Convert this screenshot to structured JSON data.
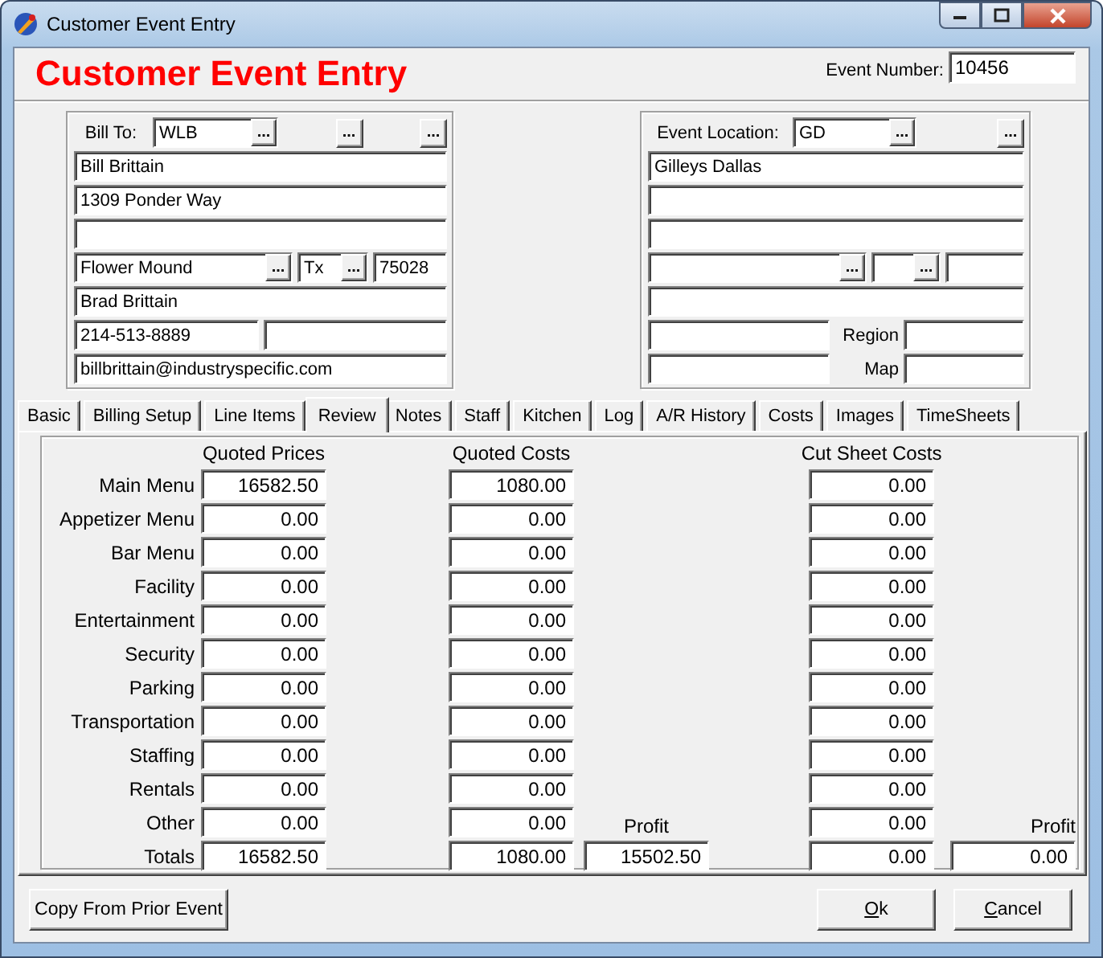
{
  "window": {
    "title": "Customer Event Entry"
  },
  "header": {
    "title": "Customer Event Entry",
    "event_number": {
      "label": "Event Number:",
      "value": "10456"
    }
  },
  "bill_to": {
    "lines": [
      {
        "items": [
          {
            "kind": "label",
            "text": "Bill To:"
          },
          {
            "kind": "field",
            "value": "WLB",
            "lookup": "..."
          },
          {
            "kind": "button",
            "text": "..."
          },
          {
            "kind": "button",
            "text": "..."
          }
        ]
      },
      {
        "items": [
          {
            "kind": "field",
            "value": "Bill Brittain"
          }
        ]
      },
      {
        "items": [
          {
            "kind": "field",
            "value": "1309 Ponder Way"
          }
        ]
      },
      {
        "items": [
          {
            "kind": "field"
          }
        ]
      },
      {
        "items": [
          {
            "kind": "field",
            "value": "Flower Mound",
            "lookup": "..."
          },
          {
            "kind": "field",
            "value": "Tx",
            "lookup": "..."
          },
          {
            "kind": "field",
            "value": "75028"
          }
        ]
      },
      {
        "items": [
          {
            "kind": "field",
            "value": "Brad Brittain"
          }
        ]
      },
      {
        "items": [
          {
            "kind": "field",
            "value": "214-513-8889"
          },
          {
            "kind": "field"
          }
        ]
      },
      {
        "items": [
          {
            "kind": "field",
            "value": "billbrittain@industryspecific.com"
          }
        ]
      }
    ]
  },
  "event_location": {
    "lines": [
      {
        "items": [
          {
            "kind": "label",
            "text": "Event Location:"
          },
          {
            "kind": "field",
            "value": "GD",
            "lookup": "..."
          },
          {
            "kind": "button",
            "text": "..."
          }
        ]
      },
      {
        "items": [
          {
            "kind": "field",
            "value": "Gilleys Dallas"
          }
        ]
      },
      {
        "items": [
          {
            "kind": "field"
          }
        ]
      },
      {
        "items": [
          {
            "kind": "field"
          }
        ]
      },
      {
        "items": [
          {
            "kind": "field",
            "lookup": "..."
          },
          {
            "kind": "field",
            "lookup": "..."
          },
          {
            "kind": "field"
          }
        ]
      },
      {
        "items": [
          {
            "kind": "field"
          }
        ]
      },
      {
        "items": [
          {
            "kind": "field"
          },
          {
            "kind": "label",
            "text": "Region"
          },
          {
            "kind": "field"
          }
        ]
      },
      {
        "items": [
          {
            "kind": "field"
          },
          {
            "kind": "label",
            "text": "Map"
          },
          {
            "kind": "field"
          }
        ]
      }
    ]
  },
  "tabs": [
    {
      "label": "Basic",
      "selected": false
    },
    {
      "label": "Billing Setup",
      "selected": false
    },
    {
      "label": "Line Items",
      "selected": false
    },
    {
      "label": "Review",
      "selected": true
    },
    {
      "label": "Notes",
      "selected": false
    },
    {
      "label": "Staff",
      "selected": false
    },
    {
      "label": "Kitchen",
      "selected": false
    },
    {
      "label": "Log",
      "selected": false
    },
    {
      "label": "A/R History",
      "selected": false
    },
    {
      "label": "Costs",
      "selected": false
    },
    {
      "label": "Images",
      "selected": false
    },
    {
      "label": "TimeSheets",
      "selected": false
    }
  ],
  "review": {
    "headings": [
      "Quoted Prices",
      "Quoted Costs",
      "Cut Sheet Costs"
    ],
    "rows": [
      {
        "label": "Main Menu",
        "quoted_price": "16582.50",
        "quoted_cost": "1080.00",
        "cut_sheet_cost": "0.00"
      },
      {
        "label": "Appetizer Menu",
        "quoted_price": "0.00",
        "quoted_cost": "0.00",
        "cut_sheet_cost": "0.00"
      },
      {
        "label": "Bar Menu",
        "quoted_price": "0.00",
        "quoted_cost": "0.00",
        "cut_sheet_cost": "0.00"
      },
      {
        "label": "Facility",
        "quoted_price": "0.00",
        "quoted_cost": "0.00",
        "cut_sheet_cost": "0.00"
      },
      {
        "label": "Entertainment",
        "quoted_price": "0.00",
        "quoted_cost": "0.00",
        "cut_sheet_cost": "0.00"
      },
      {
        "label": "Security",
        "quoted_price": "0.00",
        "quoted_cost": "0.00",
        "cut_sheet_cost": "0.00"
      },
      {
        "label": "Parking",
        "quoted_price": "0.00",
        "quoted_cost": "0.00",
        "cut_sheet_cost": "0.00"
      },
      {
        "label": "Transportation",
        "quoted_price": "0.00",
        "quoted_cost": "0.00",
        "cut_sheet_cost": "0.00"
      },
      {
        "label": "Staffing",
        "quoted_price": "0.00",
        "quoted_cost": "0.00",
        "cut_sheet_cost": "0.00"
      },
      {
        "label": "Rentals",
        "quoted_price": "0.00",
        "quoted_cost": "0.00",
        "cut_sheet_cost": "0.00"
      },
      {
        "label": "Other",
        "quoted_price": "0.00",
        "quoted_cost": "0.00",
        "cut_sheet_cost": "0.00"
      }
    ],
    "profit_labels": [
      "Profit",
      "Profit"
    ],
    "totals": {
      "label": "Totals",
      "quoted_price": "16582.50",
      "quoted_cost": "1080.00",
      "profit": "15502.50",
      "cut_sheet_cost": "0.00",
      "cut_sheet_profit": "0.00"
    }
  },
  "footer": {
    "buttons": [
      {
        "label": "Copy From Prior Event",
        "mnemonic": false
      },
      {
        "label": "Ok",
        "mnemonic": true
      },
      {
        "label": "Cancel",
        "mnemonic": true
      }
    ]
  }
}
